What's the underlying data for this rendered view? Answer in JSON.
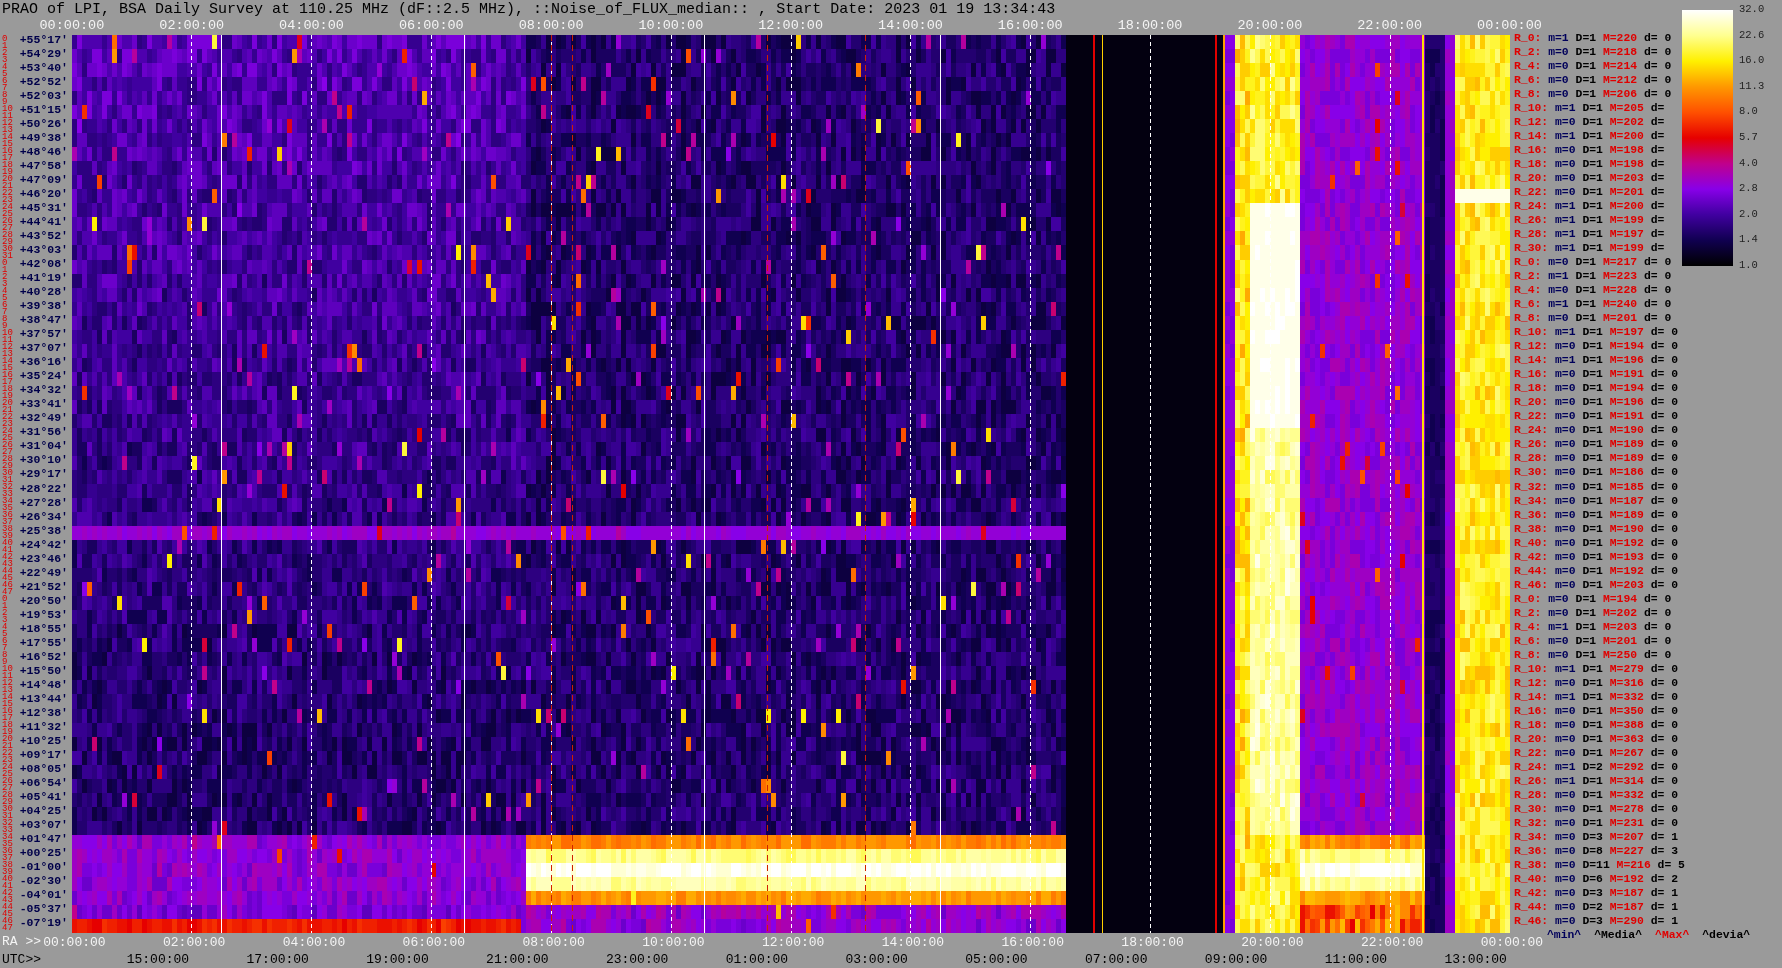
{
  "title": "PRAO of LPI, BSA Daily Survey at 110.25 MHz (dF::2.5 MHz), ::Noise_of_FLUX_median:: , Start Date: 2023 01 19 13:34:43",
  "top_axis": {
    "labels": [
      "00:00:00",
      "02:00:00",
      "04:00:00",
      "06:00:00",
      "08:00:00",
      "10:00:00",
      "12:00:00",
      "14:00:00",
      "16:00:00",
      "18:00:00",
      "20:00:00",
      "22:00:00",
      "00:00:00"
    ]
  },
  "color_scale": {
    "ticks": [
      "32.0",
      "22.6",
      "16.0",
      "11.3",
      "8.0",
      "5.7",
      "4.0",
      "2.8",
      "2.0",
      "1.4",
      "1.0"
    ]
  },
  "rows": [
    {
      "beam_numbers": [
        "0",
        "1"
      ],
      "declination": "+55°17'",
      "stats": {
        "label": "R_0:",
        "min": "m=1",
        "median": "D=1",
        "max": "M=220",
        "deviation": "d= 0"
      }
    },
    {
      "beam_numbers": [
        "2",
        "3"
      ],
      "declination": "+54°29'",
      "stats": {
        "label": "R_2:",
        "min": "m=0",
        "median": "D=1",
        "max": "M=218",
        "deviation": "d= 0"
      }
    },
    {
      "beam_numbers": [
        "4",
        "5"
      ],
      "declination": "+53°40'",
      "stats": {
        "label": "R_4:",
        "min": "m=0",
        "median": "D=1",
        "max": "M=214",
        "deviation": "d= 0"
      }
    },
    {
      "beam_numbers": [
        "6",
        "7"
      ],
      "declination": "+52°52'",
      "stats": {
        "label": "R_6:",
        "min": "m=0",
        "median": "D=1",
        "max": "M=212",
        "deviation": "d= 0"
      }
    },
    {
      "beam_numbers": [
        "8",
        "9"
      ],
      "declination": "+52°03'",
      "stats": {
        "label": "R_8:",
        "min": "m=0",
        "median": "D=1",
        "max": "M=206",
        "deviation": "d= 0"
      }
    },
    {
      "beam_numbers": [
        "10",
        "11"
      ],
      "declination": "+51°15'",
      "stats": {
        "label": "R_10:",
        "min": "m=1",
        "median": "D=1",
        "max": "M=205",
        "deviation": "d="
      }
    },
    {
      "beam_numbers": [
        "12",
        "13"
      ],
      "declination": "+50°26'",
      "stats": {
        "label": "R_12:",
        "min": "m=0",
        "median": "D=1",
        "max": "M=202",
        "deviation": "d="
      }
    },
    {
      "beam_numbers": [
        "14",
        "15"
      ],
      "declination": "+49°38'",
      "stats": {
        "label": "R_14:",
        "min": "m=1",
        "median": "D=1",
        "max": "M=200",
        "deviation": "d="
      }
    },
    {
      "beam_numbers": [
        "16",
        "17"
      ],
      "declination": "+48°46'",
      "stats": {
        "label": "R_16:",
        "min": "m=0",
        "median": "D=1",
        "max": "M=198",
        "deviation": "d="
      }
    },
    {
      "beam_numbers": [
        "18",
        "19"
      ],
      "declination": "+47°58'",
      "stats": {
        "label": "R_18:",
        "min": "m=0",
        "median": "D=1",
        "max": "M=198",
        "deviation": "d="
      }
    },
    {
      "beam_numbers": [
        "20",
        "21"
      ],
      "declination": "+47°09'",
      "stats": {
        "label": "R_20:",
        "min": "m=0",
        "median": "D=1",
        "max": "M=203",
        "deviation": "d="
      }
    },
    {
      "beam_numbers": [
        "22",
        "23"
      ],
      "declination": "+46°20'",
      "stats": {
        "label": "R_22:",
        "min": "m=0",
        "median": "D=1",
        "max": "M=201",
        "deviation": "d="
      }
    },
    {
      "beam_numbers": [
        "24",
        "25"
      ],
      "declination": "+45°31'",
      "stats": {
        "label": "R_24:",
        "min": "m=1",
        "median": "D=1",
        "max": "M=200",
        "deviation": "d="
      }
    },
    {
      "beam_numbers": [
        "26",
        "27"
      ],
      "declination": "+44°41'",
      "stats": {
        "label": "R_26:",
        "min": "m=1",
        "median": "D=1",
        "max": "M=199",
        "deviation": "d="
      }
    },
    {
      "beam_numbers": [
        "28",
        "29"
      ],
      "declination": "+43°52'",
      "stats": {
        "label": "R_28:",
        "min": "m=1",
        "median": "D=1",
        "max": "M=197",
        "deviation": "d="
      }
    },
    {
      "beam_numbers": [
        "30",
        "31"
      ],
      "declination": "+43°03'",
      "stats": {
        "label": "R_30:",
        "min": "m=1",
        "median": "D=1",
        "max": "M=199",
        "deviation": "d="
      }
    },
    {
      "beam_numbers": [
        "0",
        "1"
      ],
      "declination": "+42°08'",
      "stats": {
        "label": "R_0:",
        "min": "m=0",
        "median": "D=1",
        "max": "M=217",
        "deviation": "d= 0"
      }
    },
    {
      "beam_numbers": [
        "2",
        "3"
      ],
      "declination": "+41°19'",
      "stats": {
        "label": "R_2:",
        "min": "m=1",
        "median": "D=1",
        "max": "M=223",
        "deviation": "d= 0"
      }
    },
    {
      "beam_numbers": [
        "4",
        "5"
      ],
      "declination": "+40°28'",
      "stats": {
        "label": "R_4:",
        "min": "m=0",
        "median": "D=1",
        "max": "M=228",
        "deviation": "d= 0"
      }
    },
    {
      "beam_numbers": [
        "6",
        "7"
      ],
      "declination": "+39°38'",
      "stats": {
        "label": "R_6:",
        "min": "m=1",
        "median": "D=1",
        "max": "M=240",
        "deviation": "d= 0"
      }
    },
    {
      "beam_numbers": [
        "8",
        "9"
      ],
      "declination": "+38°47'",
      "stats": {
        "label": "R_8:",
        "min": "m=0",
        "median": "D=1",
        "max": "M=201",
        "deviation": "d= 0"
      }
    },
    {
      "beam_numbers": [
        "10",
        "11"
      ],
      "declination": "+37°57'",
      "stats": {
        "label": "R_10:",
        "min": "m=1",
        "median": "D=1",
        "max": "M=197",
        "deviation": "d= 0"
      }
    },
    {
      "beam_numbers": [
        "12",
        "13"
      ],
      "declination": "+37°07'",
      "stats": {
        "label": "R_12:",
        "min": "m=0",
        "median": "D=1",
        "max": "M=194",
        "deviation": "d= 0"
      }
    },
    {
      "beam_numbers": [
        "14",
        "15"
      ],
      "declination": "+36°16'",
      "stats": {
        "label": "R_14:",
        "min": "m=1",
        "median": "D=1",
        "max": "M=196",
        "deviation": "d= 0"
      }
    },
    {
      "beam_numbers": [
        "16",
        "17"
      ],
      "declination": "+35°24'",
      "stats": {
        "label": "R_16:",
        "min": "m=0",
        "median": "D=1",
        "max": "M=191",
        "deviation": "d= 0"
      }
    },
    {
      "beam_numbers": [
        "18",
        "19"
      ],
      "declination": "+34°32'",
      "stats": {
        "label": "R_18:",
        "min": "m=0",
        "median": "D=1",
        "max": "M=194",
        "deviation": "d= 0"
      }
    },
    {
      "beam_numbers": [
        "20",
        "21"
      ],
      "declination": "+33°41'",
      "stats": {
        "label": "R_20:",
        "min": "m=0",
        "median": "D=1",
        "max": "M=196",
        "deviation": "d= 0"
      }
    },
    {
      "beam_numbers": [
        "22",
        "23"
      ],
      "declination": "+32°49'",
      "stats": {
        "label": "R_22:",
        "min": "m=0",
        "median": "D=1",
        "max": "M=191",
        "deviation": "d= 0"
      }
    },
    {
      "beam_numbers": [
        "24",
        "25"
      ],
      "declination": "+31°56'",
      "stats": {
        "label": "R_24:",
        "min": "m=0",
        "median": "D=1",
        "max": "M=190",
        "deviation": "d= 0"
      }
    },
    {
      "beam_numbers": [
        "26",
        "27"
      ],
      "declination": "+31°04'",
      "stats": {
        "label": "R_26:",
        "min": "m=0",
        "median": "D=1",
        "max": "M=189",
        "deviation": "d= 0"
      }
    },
    {
      "beam_numbers": [
        "28",
        "29"
      ],
      "declination": "+30°10'",
      "stats": {
        "label": "R_28:",
        "min": "m=0",
        "median": "D=1",
        "max": "M=189",
        "deviation": "d= 0"
      }
    },
    {
      "beam_numbers": [
        "30",
        "31"
      ],
      "declination": "+29°17'",
      "stats": {
        "label": "R_30:",
        "min": "m=0",
        "median": "D=1",
        "max": "M=186",
        "deviation": "d= 0"
      }
    },
    {
      "beam_numbers": [
        "32",
        "33"
      ],
      "declination": "+28°22'",
      "stats": {
        "label": "R_32:",
        "min": "m=0",
        "median": "D=1",
        "max": "M=185",
        "deviation": "d= 0"
      }
    },
    {
      "beam_numbers": [
        "34",
        "35"
      ],
      "declination": "+27°28'",
      "stats": {
        "label": "R_34:",
        "min": "m=0",
        "median": "D=1",
        "max": "M=187",
        "deviation": "d= 0"
      }
    },
    {
      "beam_numbers": [
        "36",
        "37"
      ],
      "declination": "+26°34'",
      "stats": {
        "label": "R_36:",
        "min": "m=0",
        "median": "D=1",
        "max": "M=189",
        "deviation": "d= 0"
      }
    },
    {
      "beam_numbers": [
        "38",
        "39"
      ],
      "declination": "+25°38'",
      "stats": {
        "label": "R_38:",
        "min": "m=0",
        "median": "D=1",
        "max": "M=190",
        "deviation": "d= 0"
      }
    },
    {
      "beam_numbers": [
        "40",
        "41"
      ],
      "declination": "+24°42'",
      "stats": {
        "label": "R_40:",
        "min": "m=0",
        "median": "D=1",
        "max": "M=192",
        "deviation": "d= 0"
      }
    },
    {
      "beam_numbers": [
        "42",
        "43"
      ],
      "declination": "+23°46'",
      "stats": {
        "label": "R_42:",
        "min": "m=0",
        "median": "D=1",
        "max": "M=193",
        "deviation": "d= 0"
      }
    },
    {
      "beam_numbers": [
        "44",
        "45"
      ],
      "declination": "+22°49'",
      "stats": {
        "label": "R_44:",
        "min": "m=0",
        "median": "D=1",
        "max": "M=192",
        "deviation": "d= 0"
      }
    },
    {
      "beam_numbers": [
        "46",
        "47"
      ],
      "declination": "+21°52'",
      "stats": {
        "label": "R_46:",
        "min": "m=0",
        "median": "D=1",
        "max": "M=203",
        "deviation": "d= 0"
      }
    },
    {
      "beam_numbers": [
        "0",
        "1"
      ],
      "declination": "+20°50'",
      "stats": {
        "label": "R_0:",
        "min": "m=0",
        "median": "D=1",
        "max": "M=194",
        "deviation": "d= 0"
      }
    },
    {
      "beam_numbers": [
        "2",
        "3"
      ],
      "declination": "+19°53'",
      "stats": {
        "label": "R_2:",
        "min": "m=0",
        "median": "D=1",
        "max": "M=202",
        "deviation": "d= 0"
      }
    },
    {
      "beam_numbers": [
        "4",
        "5"
      ],
      "declination": "+18°55'",
      "stats": {
        "label": "R_4:",
        "min": "m=1",
        "median": "D=1",
        "max": "M=203",
        "deviation": "d= 0"
      }
    },
    {
      "beam_numbers": [
        "6",
        "7"
      ],
      "declination": "+17°55'",
      "stats": {
        "label": "R_6:",
        "min": "m=0",
        "median": "D=1",
        "max": "M=201",
        "deviation": "d= 0"
      }
    },
    {
      "beam_numbers": [
        "8",
        "9"
      ],
      "declination": "+16°52'",
      "stats": {
        "label": "R_8:",
        "min": "m=0",
        "median": "D=1",
        "max": "M=250",
        "deviation": "d= 0"
      }
    },
    {
      "beam_numbers": [
        "10",
        "11"
      ],
      "declination": "+15°50'",
      "stats": {
        "label": "R_10:",
        "min": "m=1",
        "median": "D=1",
        "max": "M=279",
        "deviation": "d= 0"
      }
    },
    {
      "beam_numbers": [
        "12",
        "13"
      ],
      "declination": "+14°48'",
      "stats": {
        "label": "R_12:",
        "min": "m=0",
        "median": "D=1",
        "max": "M=316",
        "deviation": "d= 0"
      }
    },
    {
      "beam_numbers": [
        "14",
        "15"
      ],
      "declination": "+13°44'",
      "stats": {
        "label": "R_14:",
        "min": "m=1",
        "median": "D=1",
        "max": "M=332",
        "deviation": "d= 0"
      }
    },
    {
      "beam_numbers": [
        "16",
        "17"
      ],
      "declination": "+12°38'",
      "stats": {
        "label": "R_16:",
        "min": "m=0",
        "median": "D=1",
        "max": "M=350",
        "deviation": "d= 0"
      }
    },
    {
      "beam_numbers": [
        "18",
        "19"
      ],
      "declination": "+11°32'",
      "stats": {
        "label": "R_18:",
        "min": "m=0",
        "median": "D=1",
        "max": "M=388",
        "deviation": "d= 0"
      }
    },
    {
      "beam_numbers": [
        "20",
        "21"
      ],
      "declination": "+10°25'",
      "stats": {
        "label": "R_20:",
        "min": "m=0",
        "median": "D=1",
        "max": "M=363",
        "deviation": "d= 0"
      }
    },
    {
      "beam_numbers": [
        "22",
        "23"
      ],
      "declination": "+09°17'",
      "stats": {
        "label": "R_22:",
        "min": "m=0",
        "median": "D=1",
        "max": "M=267",
        "deviation": "d= 0"
      }
    },
    {
      "beam_numbers": [
        "24",
        "25"
      ],
      "declination": "+08°05'",
      "stats": {
        "label": "R_24:",
        "min": "m=1",
        "median": "D=2",
        "max": "M=292",
        "deviation": "d= 0"
      }
    },
    {
      "beam_numbers": [
        "26",
        "27"
      ],
      "declination": "+06°54'",
      "stats": {
        "label": "R_26:",
        "min": "m=1",
        "median": "D=1",
        "max": "M=314",
        "deviation": "d= 0"
      }
    },
    {
      "beam_numbers": [
        "28",
        "29"
      ],
      "declination": "+05°41'",
      "stats": {
        "label": "R_28:",
        "min": "m=0",
        "median": "D=1",
        "max": "M=332",
        "deviation": "d= 0"
      }
    },
    {
      "beam_numbers": [
        "30",
        "31"
      ],
      "declination": "+04°25'",
      "stats": {
        "label": "R_30:",
        "min": "m=0",
        "median": "D=1",
        "max": "M=278",
        "deviation": "d= 0"
      }
    },
    {
      "beam_numbers": [
        "32",
        "33"
      ],
      "declination": "+03°07'",
      "stats": {
        "label": "R_32:",
        "min": "m=0",
        "median": "D=1",
        "max": "M=231",
        "deviation": "d= 0"
      }
    },
    {
      "beam_numbers": [
        "34",
        "35"
      ],
      "declination": "+01°47'",
      "stats": {
        "label": "R_34:",
        "min": "m=0",
        "median": "D=3",
        "max": "M=207",
        "deviation": "d= 1"
      }
    },
    {
      "beam_numbers": [
        "36",
        "37"
      ],
      "declination": "+00°25'",
      "stats": {
        "label": "R_36:",
        "min": "m=0",
        "median": "D=8",
        "max": "M=227",
        "deviation": "d= 3"
      }
    },
    {
      "beam_numbers": [
        "38",
        "39"
      ],
      "declination": "-01°00'",
      "stats": {
        "label": "R_38:",
        "min": "m=0",
        "median": "D=11",
        "max": "M=216",
        "deviation": "d= 5"
      }
    },
    {
      "beam_numbers": [
        "40",
        "41"
      ],
      "declination": "-02°30'",
      "stats": {
        "label": "R_40:",
        "min": "m=0",
        "median": "D=6",
        "max": "M=192",
        "deviation": "d= 2"
      }
    },
    {
      "beam_numbers": [
        "42",
        "43"
      ],
      "declination": "-04°01'",
      "stats": {
        "label": "R_42:",
        "min": "m=0",
        "median": "D=3",
        "max": "M=187",
        "deviation": "d= 1"
      }
    },
    {
      "beam_numbers": [
        "44",
        "45"
      ],
      "declination": "-05°37'",
      "stats": {
        "label": "R_44:",
        "min": "m=0",
        "median": "D=2",
        "max": "M=187",
        "deviation": "d= 1"
      }
    },
    {
      "beam_numbers": [
        "46",
        "47"
      ],
      "declination": "-07°19'",
      "stats": {
        "label": "R_46:",
        "min": "m=0",
        "median": "D=3",
        "max": "M=290",
        "deviation": "d= 1"
      }
    }
  ],
  "stats_legend": [
    {
      "label": "^min^",
      "kind": "min"
    },
    {
      "label": "^Media^",
      "kind": "median"
    },
    {
      "label": "^Max^",
      "kind": "max"
    },
    {
      "label": "^devia^",
      "kind": "deviation"
    }
  ],
  "bottom_axes": {
    "ra": {
      "prefix": "RA >>",
      "labels": [
        "00:00:00",
        "02:00:00",
        "04:00:00",
        "06:00:00",
        "08:00:00",
        "10:00:00",
        "12:00:00",
        "14:00:00",
        "16:00:00",
        "18:00:00",
        "20:00:00",
        "22:00:00",
        "00:00:00"
      ]
    },
    "utc": {
      "prefix": "UTC>>",
      "labels": [
        "15:00:00",
        "17:00:00",
        "19:00:00",
        "21:00:00",
        "23:00:00",
        "01:00:00",
        "03:00:00",
        "05:00:00",
        "07:00:00",
        "09:00:00",
        "11:00:00",
        "13:00:00"
      ]
    }
  }
}
